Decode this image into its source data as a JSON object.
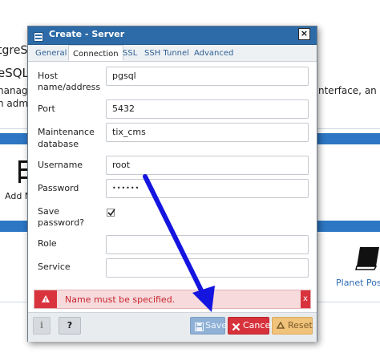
{
  "background": {
    "fragment_1": "tgreS",
    "fragment_2": "eSQL",
    "fragment_3": "nanage",
    "fragment_4": "n admi",
    "fragment_5": "nterface, an SQL",
    "add_link": "Add N",
    "planet_link": "Planet Postg"
  },
  "dialog": {
    "title": "Create - Server",
    "close_label": "×",
    "tabs": [
      "General",
      "Connection",
      "SSL",
      "SSH Tunnel",
      "Advanced"
    ],
    "active_tab": "Connection",
    "fields": {
      "host_label_1": "Host",
      "host_label_2": "name/address",
      "host_value": "pgsql",
      "port_label": "Port",
      "port_value": "5432",
      "maint_label_1": "Maintenance",
      "maint_label_2": "database",
      "maint_value": "tix_cms",
      "username_label": "Username",
      "username_value": "root",
      "password_label": "Password",
      "password_value": "••••••",
      "save_pw_label_1": "Save",
      "save_pw_label_2": "password?",
      "save_pw_checked": true,
      "role_label": "Role",
      "role_value": "",
      "service_label": "Service",
      "service_value": ""
    },
    "error": {
      "message": "Name must be specified.",
      "close_label": "x"
    },
    "footer": {
      "info_label": "i",
      "help_label": "?",
      "save_label": "Save",
      "cancel_label": "Cancel",
      "reset_label": "Reset"
    }
  },
  "colors": {
    "titlebar": "#2d6ba8",
    "error": "#d9343d",
    "arrow": "#1515e0",
    "save": "#8fb1d6",
    "cancel": "#d7323b",
    "reset": "#f0c27a"
  },
  "icons": {
    "title": "server-icon",
    "error": "warning-icon",
    "save": "floppy-icon",
    "cancel": "x-icon",
    "reset": "recycle-icon",
    "bg_left": "server-icon",
    "bg_right": "book-icon"
  }
}
